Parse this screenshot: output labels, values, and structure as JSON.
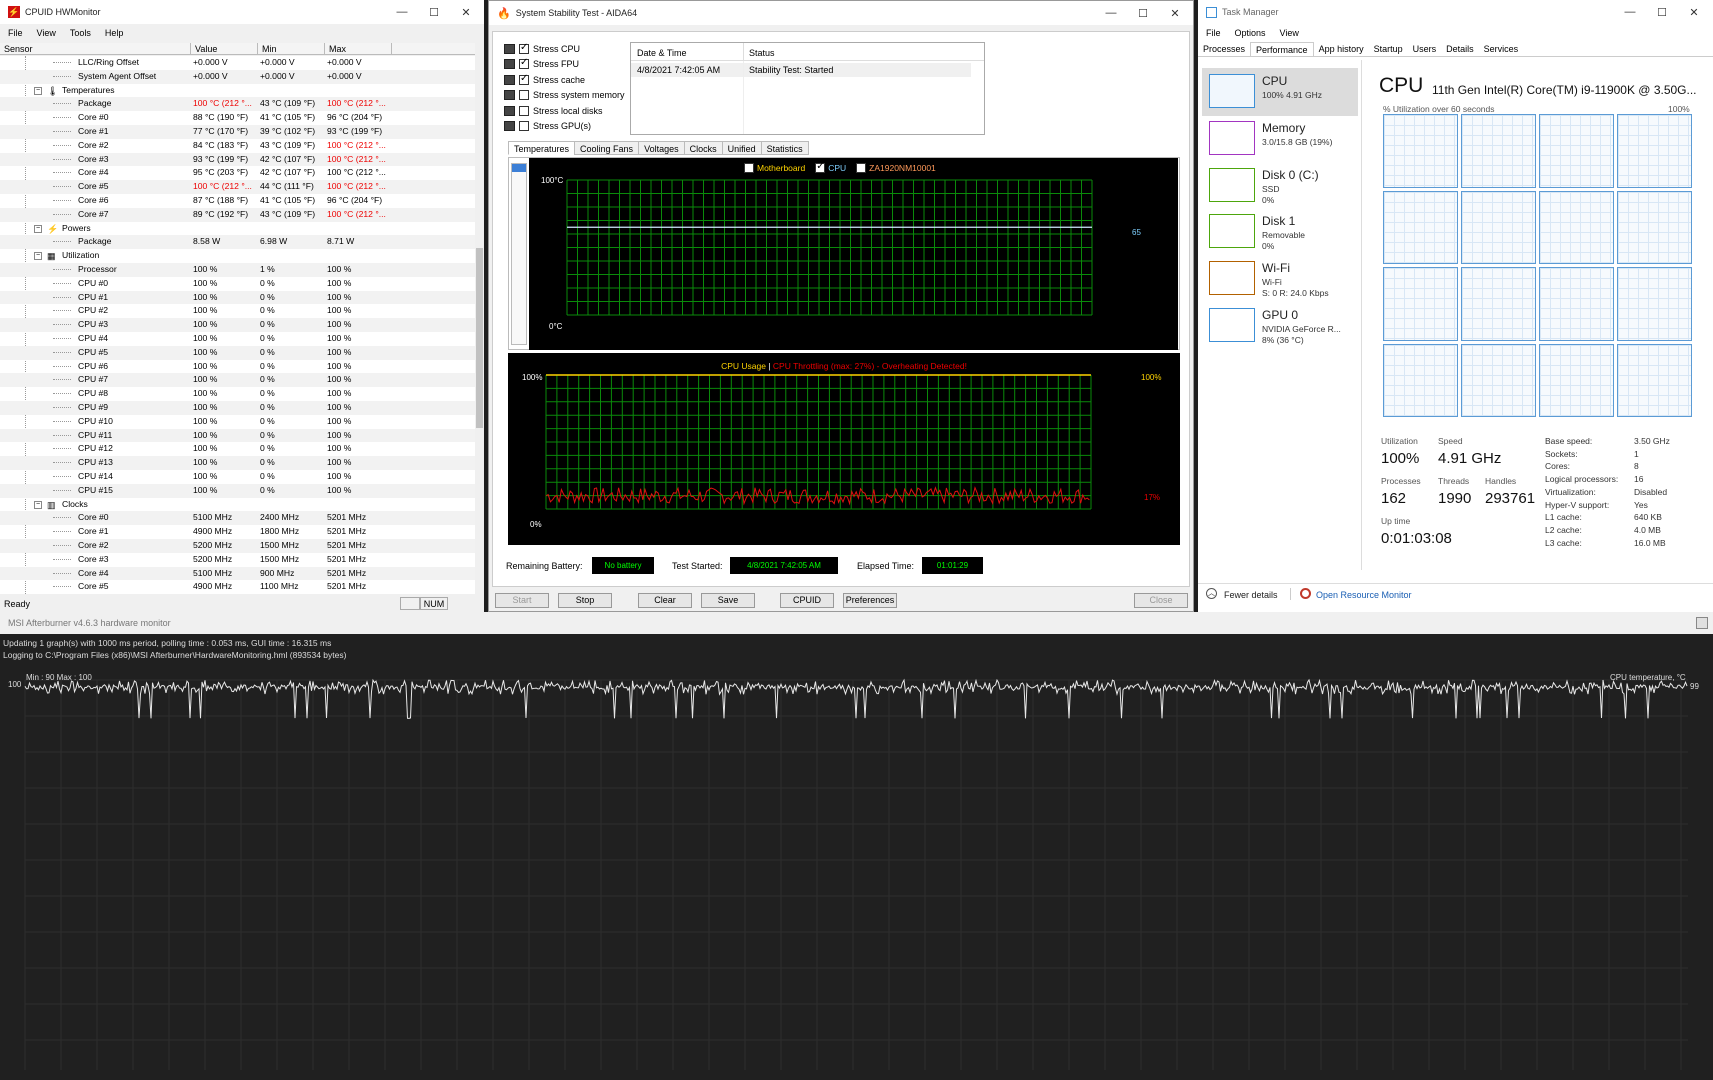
{
  "hwmonitor": {
    "title": "CPUID HWMonitor",
    "menu": [
      "File",
      "View",
      "Tools",
      "Help"
    ],
    "columns": [
      "Sensor",
      "Value",
      "Min",
      "Max"
    ],
    "status_left": "Ready",
    "status_num": "NUM",
    "rows": [
      {
        "indent": 3,
        "name": "LLC/Ring Offset",
        "value": "+0.000 V",
        "min": "+0.000 V",
        "max": "+0.000 V"
      },
      {
        "indent": 3,
        "name": "System Agent Offset",
        "value": "+0.000 V",
        "min": "+0.000 V",
        "max": "+0.000 V"
      },
      {
        "indent": 2,
        "group": true,
        "icon": "thermometer-icon",
        "name": "Temperatures",
        "value": "",
        "min": "",
        "max": ""
      },
      {
        "indent": 3,
        "name": "Package",
        "value": "100 °C (212 °...",
        "min": "43 °C (109 °F)",
        "max": "100 °C (212 °...",
        "vred": true,
        "maxred": true
      },
      {
        "indent": 3,
        "name": "Core #0",
        "value": "88 °C (190 °F)",
        "min": "41 °C (105 °F)",
        "max": "96 °C (204 °F)"
      },
      {
        "indent": 3,
        "name": "Core #1",
        "value": "77 °C (170 °F)",
        "min": "39 °C (102 °F)",
        "max": "93 °C (199 °F)"
      },
      {
        "indent": 3,
        "name": "Core #2",
        "value": "84 °C (183 °F)",
        "min": "43 °C (109 °F)",
        "max": "100 °C (212 °...",
        "maxred": true
      },
      {
        "indent": 3,
        "name": "Core #3",
        "value": "93 °C (199 °F)",
        "min": "42 °C (107 °F)",
        "max": "100 °C (212 °...",
        "maxred": true
      },
      {
        "indent": 3,
        "name": "Core #4",
        "value": "95 °C (203 °F)",
        "min": "42 °C (107 °F)",
        "max": "100 °C (212 °..."
      },
      {
        "indent": 3,
        "name": "Core #5",
        "value": "100 °C (212 °...",
        "min": "44 °C (111 °F)",
        "max": "100 °C (212 °...",
        "vred": true,
        "maxred": true
      },
      {
        "indent": 3,
        "name": "Core #6",
        "value": "87 °C (188 °F)",
        "min": "41 °C (105 °F)",
        "max": "96 °C (204 °F)"
      },
      {
        "indent": 3,
        "name": "Core #7",
        "value": "89 °C (192 °F)",
        "min": "43 °C (109 °F)",
        "max": "100 °C (212 °...",
        "maxred": true
      },
      {
        "indent": 2,
        "group": true,
        "icon": "power-icon",
        "name": "Powers",
        "value": "",
        "min": "",
        "max": ""
      },
      {
        "indent": 3,
        "name": "Package",
        "value": "8.58 W",
        "min": "6.98 W",
        "max": "8.71 W"
      },
      {
        "indent": 2,
        "group": true,
        "icon": "utilization-icon",
        "name": "Utilization",
        "value": "",
        "min": "",
        "max": ""
      },
      {
        "indent": 3,
        "name": "Processor",
        "value": "100 %",
        "min": "1 %",
        "max": "100 %"
      },
      {
        "indent": 3,
        "name": "CPU #0",
        "value": "100 %",
        "min": "0 %",
        "max": "100 %"
      },
      {
        "indent": 3,
        "name": "CPU #1",
        "value": "100 %",
        "min": "0 %",
        "max": "100 %"
      },
      {
        "indent": 3,
        "name": "CPU #2",
        "value": "100 %",
        "min": "0 %",
        "max": "100 %"
      },
      {
        "indent": 3,
        "name": "CPU #3",
        "value": "100 %",
        "min": "0 %",
        "max": "100 %"
      },
      {
        "indent": 3,
        "name": "CPU #4",
        "value": "100 %",
        "min": "0 %",
        "max": "100 %"
      },
      {
        "indent": 3,
        "name": "CPU #5",
        "value": "100 %",
        "min": "0 %",
        "max": "100 %"
      },
      {
        "indent": 3,
        "name": "CPU #6",
        "value": "100 %",
        "min": "0 %",
        "max": "100 %"
      },
      {
        "indent": 3,
        "name": "CPU #7",
        "value": "100 %",
        "min": "0 %",
        "max": "100 %"
      },
      {
        "indent": 3,
        "name": "CPU #8",
        "value": "100 %",
        "min": "0 %",
        "max": "100 %"
      },
      {
        "indent": 3,
        "name": "CPU #9",
        "value": "100 %",
        "min": "0 %",
        "max": "100 %"
      },
      {
        "indent": 3,
        "name": "CPU #10",
        "value": "100 %",
        "min": "0 %",
        "max": "100 %"
      },
      {
        "indent": 3,
        "name": "CPU #11",
        "value": "100 %",
        "min": "0 %",
        "max": "100 %"
      },
      {
        "indent": 3,
        "name": "CPU #12",
        "value": "100 %",
        "min": "0 %",
        "max": "100 %"
      },
      {
        "indent": 3,
        "name": "CPU #13",
        "value": "100 %",
        "min": "0 %",
        "max": "100 %"
      },
      {
        "indent": 3,
        "name": "CPU #14",
        "value": "100 %",
        "min": "0 %",
        "max": "100 %"
      },
      {
        "indent": 3,
        "name": "CPU #15",
        "value": "100 %",
        "min": "0 %",
        "max": "100 %"
      },
      {
        "indent": 2,
        "group": true,
        "icon": "clock-icon",
        "name": "Clocks",
        "value": "",
        "min": "",
        "max": ""
      },
      {
        "indent": 3,
        "name": "Core #0",
        "value": "5100 MHz",
        "min": "2400 MHz",
        "max": "5201 MHz"
      },
      {
        "indent": 3,
        "name": "Core #1",
        "value": "4900 MHz",
        "min": "1800 MHz",
        "max": "5201 MHz"
      },
      {
        "indent": 3,
        "name": "Core #2",
        "value": "5200 MHz",
        "min": "1500 MHz",
        "max": "5201 MHz"
      },
      {
        "indent": 3,
        "name": "Core #3",
        "value": "5200 MHz",
        "min": "1500 MHz",
        "max": "5201 MHz"
      },
      {
        "indent": 3,
        "name": "Core #4",
        "value": "5100 MHz",
        "min": "900 MHz",
        "max": "5201 MHz"
      },
      {
        "indent": 3,
        "name": "Core #5",
        "value": "4900 MHz",
        "min": "1100 MHz",
        "max": "5201 MHz"
      }
    ]
  },
  "aida": {
    "title": "System Stability Test - AIDA64",
    "stress": [
      {
        "label": "Stress CPU",
        "checked": true
      },
      {
        "label": "Stress FPU",
        "checked": true
      },
      {
        "label": "Stress cache",
        "checked": true
      },
      {
        "label": "Stress system memory",
        "checked": false
      },
      {
        "label": "Stress local disks",
        "checked": false
      },
      {
        "label": "Stress GPU(s)",
        "checked": false
      }
    ],
    "log_headers": [
      "Date & Time",
      "Status"
    ],
    "log_row": {
      "datetime": "4/8/2021 7:42:05 AM",
      "status": "Stability Test: Started"
    },
    "tabs": [
      "Temperatures",
      "Cooling Fans",
      "Voltages",
      "Clocks",
      "Unified",
      "Statistics"
    ],
    "temp_graph": {
      "legend": [
        "Motherboard",
        "CPU",
        "ZA1920NM10001"
      ],
      "legend_checked": [
        false,
        true,
        false
      ],
      "ymax_label": "100°C",
      "ymin_label": "0°C",
      "current_label": "65"
    },
    "usage_graph": {
      "title_left": "CPU Usage",
      "separator": "|",
      "title_right": "CPU Throttling (max: 27%) - Overheating Detected!",
      "ymax_label": "100%",
      "ymin_label": "0%",
      "right_top": "100%",
      "right_value": "17%"
    },
    "footer": {
      "battery_label": "Remaining Battery:",
      "battery_value": "No battery",
      "started_label": "Test Started:",
      "started_value": "4/8/2021 7:42:05 AM",
      "elapsed_label": "Elapsed Time:",
      "elapsed_value": "01:01:29"
    },
    "buttons": [
      "Start",
      "Stop",
      "Clear",
      "Save",
      "CPUID",
      "Preferences",
      "Close"
    ]
  },
  "tm": {
    "title": "Task Manager",
    "menu": [
      "File",
      "Options",
      "View"
    ],
    "tabs": [
      "Processes",
      "Performance",
      "App history",
      "Startup",
      "Users",
      "Details",
      "Services"
    ],
    "side": [
      {
        "name": "CPU",
        "l2": "100% 4.91 GHz",
        "l3": "",
        "color": "#3c8fd6"
      },
      {
        "name": "Memory",
        "l2": "3.0/15.8 GB (19%)",
        "l3": "",
        "color": "#a235c1"
      },
      {
        "name": "Disk 0 (C:)",
        "l2": "SSD",
        "l3": "0%",
        "color": "#4da60c"
      },
      {
        "name": "Disk 1",
        "l2": "Removable",
        "l3": "0%",
        "color": "#4da60c"
      },
      {
        "name": "Wi-Fi",
        "l2": "Wi-Fi",
        "l3": "S: 0 R: 24.0 Kbps",
        "color": "#b26100"
      },
      {
        "name": "GPU 0",
        "l2": "NVIDIA GeForce R...",
        "l3": "8% (36 °C)",
        "color": "#3c8fd6"
      }
    ],
    "main_title": "CPU",
    "cpu_name": "11th Gen Intel(R) Core(TM) i9-11900K @ 3.50G...",
    "graph_label": "% Utilization over 60 seconds",
    "graph_max": "100%",
    "stats": {
      "utilization_label": "Utilization",
      "utilization": "100%",
      "speed_label": "Speed",
      "speed": "4.91 GHz",
      "processes_label": "Processes",
      "processes": "162",
      "threads_label": "Threads",
      "threads": "1990",
      "handles_label": "Handles",
      "handles": "293761",
      "uptime_label": "Up time",
      "uptime": "0:01:03:08"
    },
    "specs": [
      [
        "Base speed:",
        "3.50 GHz"
      ],
      [
        "Sockets:",
        "1"
      ],
      [
        "Cores:",
        "8"
      ],
      [
        "Logical processors:",
        "16"
      ],
      [
        "Virtualization:",
        "Disabled"
      ],
      [
        "Hyper-V support:",
        "Yes"
      ],
      [
        "L1 cache:",
        "640 KB"
      ],
      [
        "L2 cache:",
        "4.0 MB"
      ],
      [
        "L3 cache:",
        "16.0 MB"
      ]
    ],
    "fewer_details": "Fewer details",
    "open_resmon": "Open Resource Monitor"
  },
  "msi": {
    "title": "MSI Afterburner v4.6.3 hardware monitor",
    "info1": "Updating 1 graph(s) with 1000 ms period, polling time : 0.053 ms, GUI time : 16.315 ms",
    "info2": "Logging to C:\\Program Files (x86)\\MSI Afterburner\\HardwareMonitoring.hml (893534 bytes)",
    "minmax": "Min : 90   Max : 100",
    "graph_name": "CPU temperature, °C",
    "y_label": "100",
    "current": "99"
  }
}
